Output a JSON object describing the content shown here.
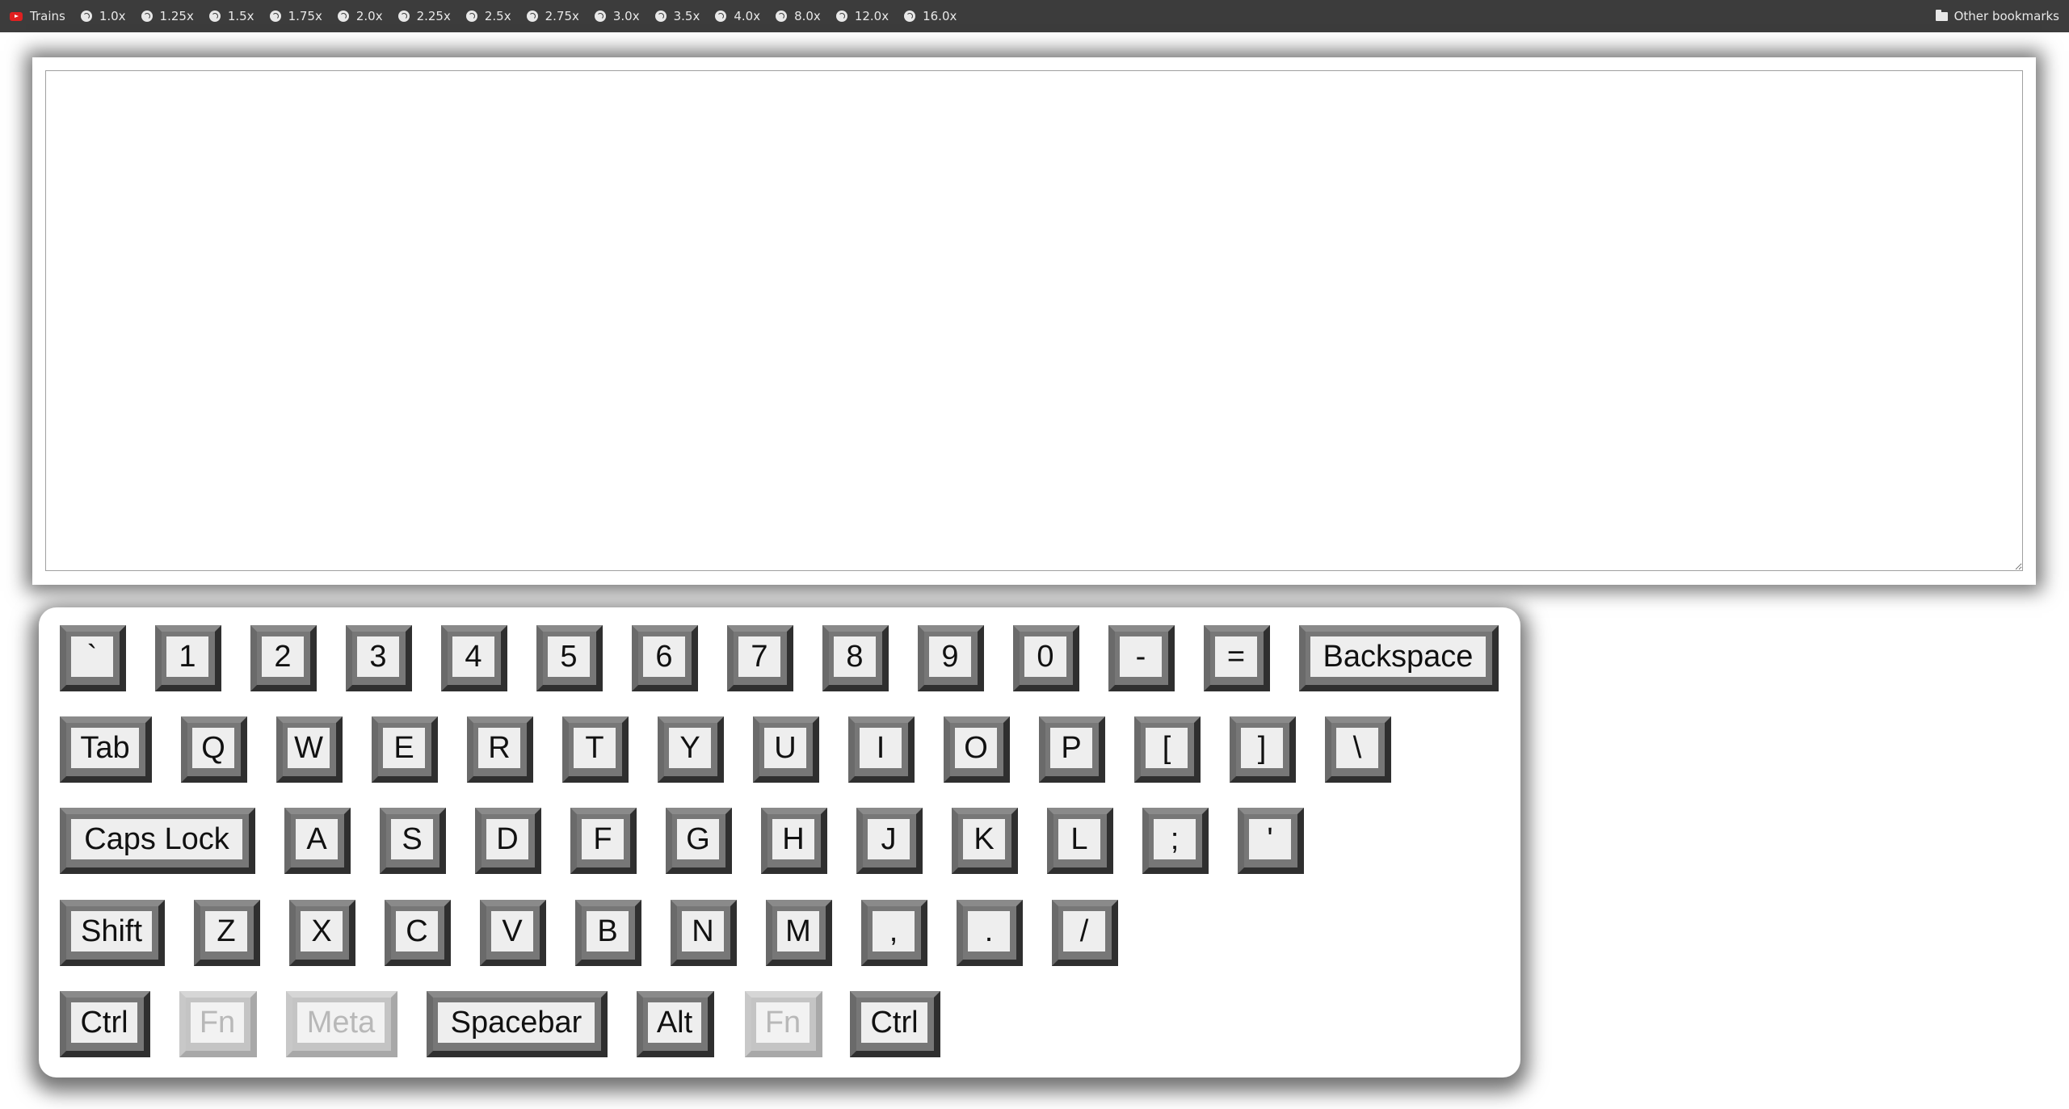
{
  "bookmarks_bar": {
    "items": [
      {
        "label": "Trains",
        "icon": "youtube-icon"
      },
      {
        "label": "1.0x",
        "icon": "globe-icon"
      },
      {
        "label": "1.25x",
        "icon": "globe-icon"
      },
      {
        "label": "1.5x",
        "icon": "globe-icon"
      },
      {
        "label": "1.75x",
        "icon": "globe-icon"
      },
      {
        "label": "2.0x",
        "icon": "globe-icon"
      },
      {
        "label": "2.25x",
        "icon": "globe-icon"
      },
      {
        "label": "2.5x",
        "icon": "globe-icon"
      },
      {
        "label": "2.75x",
        "icon": "globe-icon"
      },
      {
        "label": "3.0x",
        "icon": "globe-icon"
      },
      {
        "label": "3.5x",
        "icon": "globe-icon"
      },
      {
        "label": "4.0x",
        "icon": "globe-icon"
      },
      {
        "label": "8.0x",
        "icon": "globe-icon"
      },
      {
        "label": "12.0x",
        "icon": "globe-icon"
      },
      {
        "label": "16.0x",
        "icon": "globe-icon"
      }
    ],
    "other_bookmarks": {
      "label": "Other bookmarks",
      "icon": "folder-icon"
    }
  },
  "text_area": {
    "value": ""
  },
  "keyboard": {
    "row1": [
      "`",
      "1",
      "2",
      "3",
      "4",
      "5",
      "6",
      "7",
      "8",
      "9",
      "0",
      "-",
      "=",
      "Backspace"
    ],
    "row2": [
      "Tab",
      "Q",
      "W",
      "E",
      "R",
      "T",
      "Y",
      "U",
      "I",
      "O",
      "P",
      "[",
      "]",
      "\\"
    ],
    "row3": [
      "Caps Lock",
      "A",
      "S",
      "D",
      "F",
      "G",
      "H",
      "J",
      "K",
      "L",
      ";",
      "'"
    ],
    "row4": [
      "Shift",
      "Z",
      "X",
      "C",
      "V",
      "B",
      "N",
      "M",
      ",",
      ".",
      "/"
    ],
    "row5": [
      "Ctrl",
      "Fn",
      "Meta",
      "Spacebar",
      "Alt",
      "Fn",
      "Ctrl"
    ],
    "disabled_keys": [
      "Fn",
      "Meta"
    ]
  }
}
